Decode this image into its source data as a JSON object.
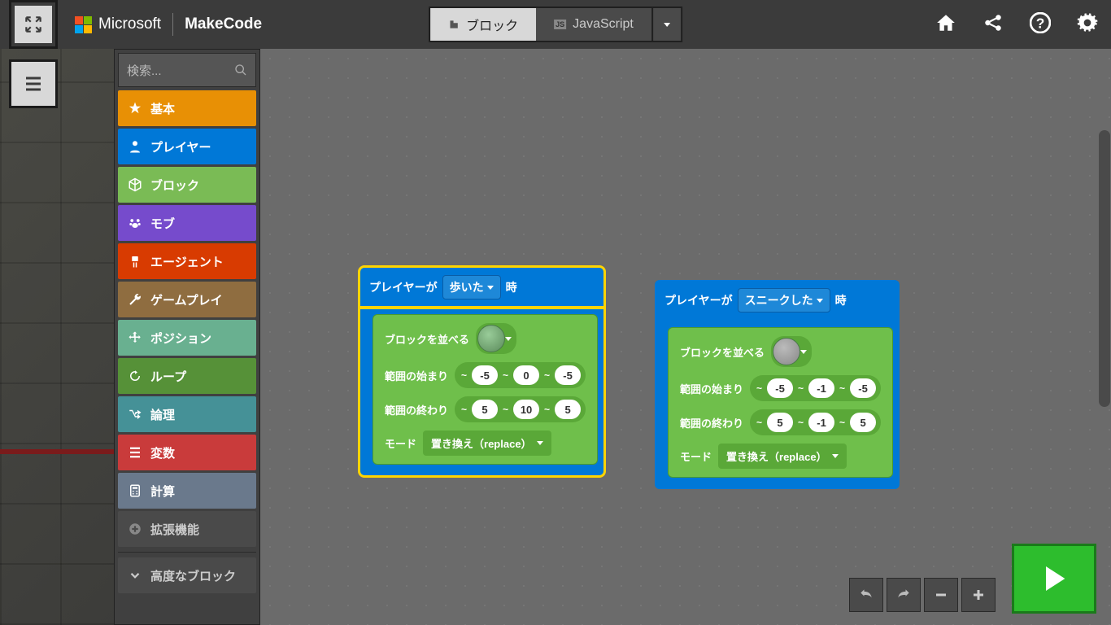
{
  "brand": {
    "ms": "Microsoft",
    "app": "MakeCode"
  },
  "modes": {
    "blocks": "ブロック",
    "js": "JavaScript"
  },
  "search": {
    "placeholder": "検索..."
  },
  "cats": {
    "basic": "基本",
    "player": "プレイヤー",
    "blocks": "ブロック",
    "mobs": "モブ",
    "agent": "エージェント",
    "gameplay": "ゲームプレイ",
    "positions": "ポジション",
    "loops": "ループ",
    "logic": "論理",
    "variables": "変数",
    "math": "計算",
    "extensions": "拡張機能",
    "advanced": "高度なブロック"
  },
  "block1": {
    "hat_pre": "プレイヤーが",
    "hat_action": "歩いた",
    "hat_post": "時",
    "fill": "ブロックを並べる",
    "from_label": "範囲の始まり",
    "from": [
      "-5",
      "0",
      "-5"
    ],
    "to_label": "範囲の終わり",
    "to": [
      "5",
      "10",
      "5"
    ],
    "mode_label": "モード",
    "mode_val": "置き換え（replace）"
  },
  "block2": {
    "hat_pre": "プレイヤーが",
    "hat_action": "スニークした",
    "hat_post": "時",
    "fill": "ブロックを並べる",
    "from_label": "範囲の始まり",
    "from": [
      "-5",
      "-1",
      "-5"
    ],
    "to_label": "範囲の終わり",
    "to": [
      "5",
      "-1",
      "5"
    ],
    "mode_label": "モード",
    "mode_val": "置き換え（replace）"
  }
}
